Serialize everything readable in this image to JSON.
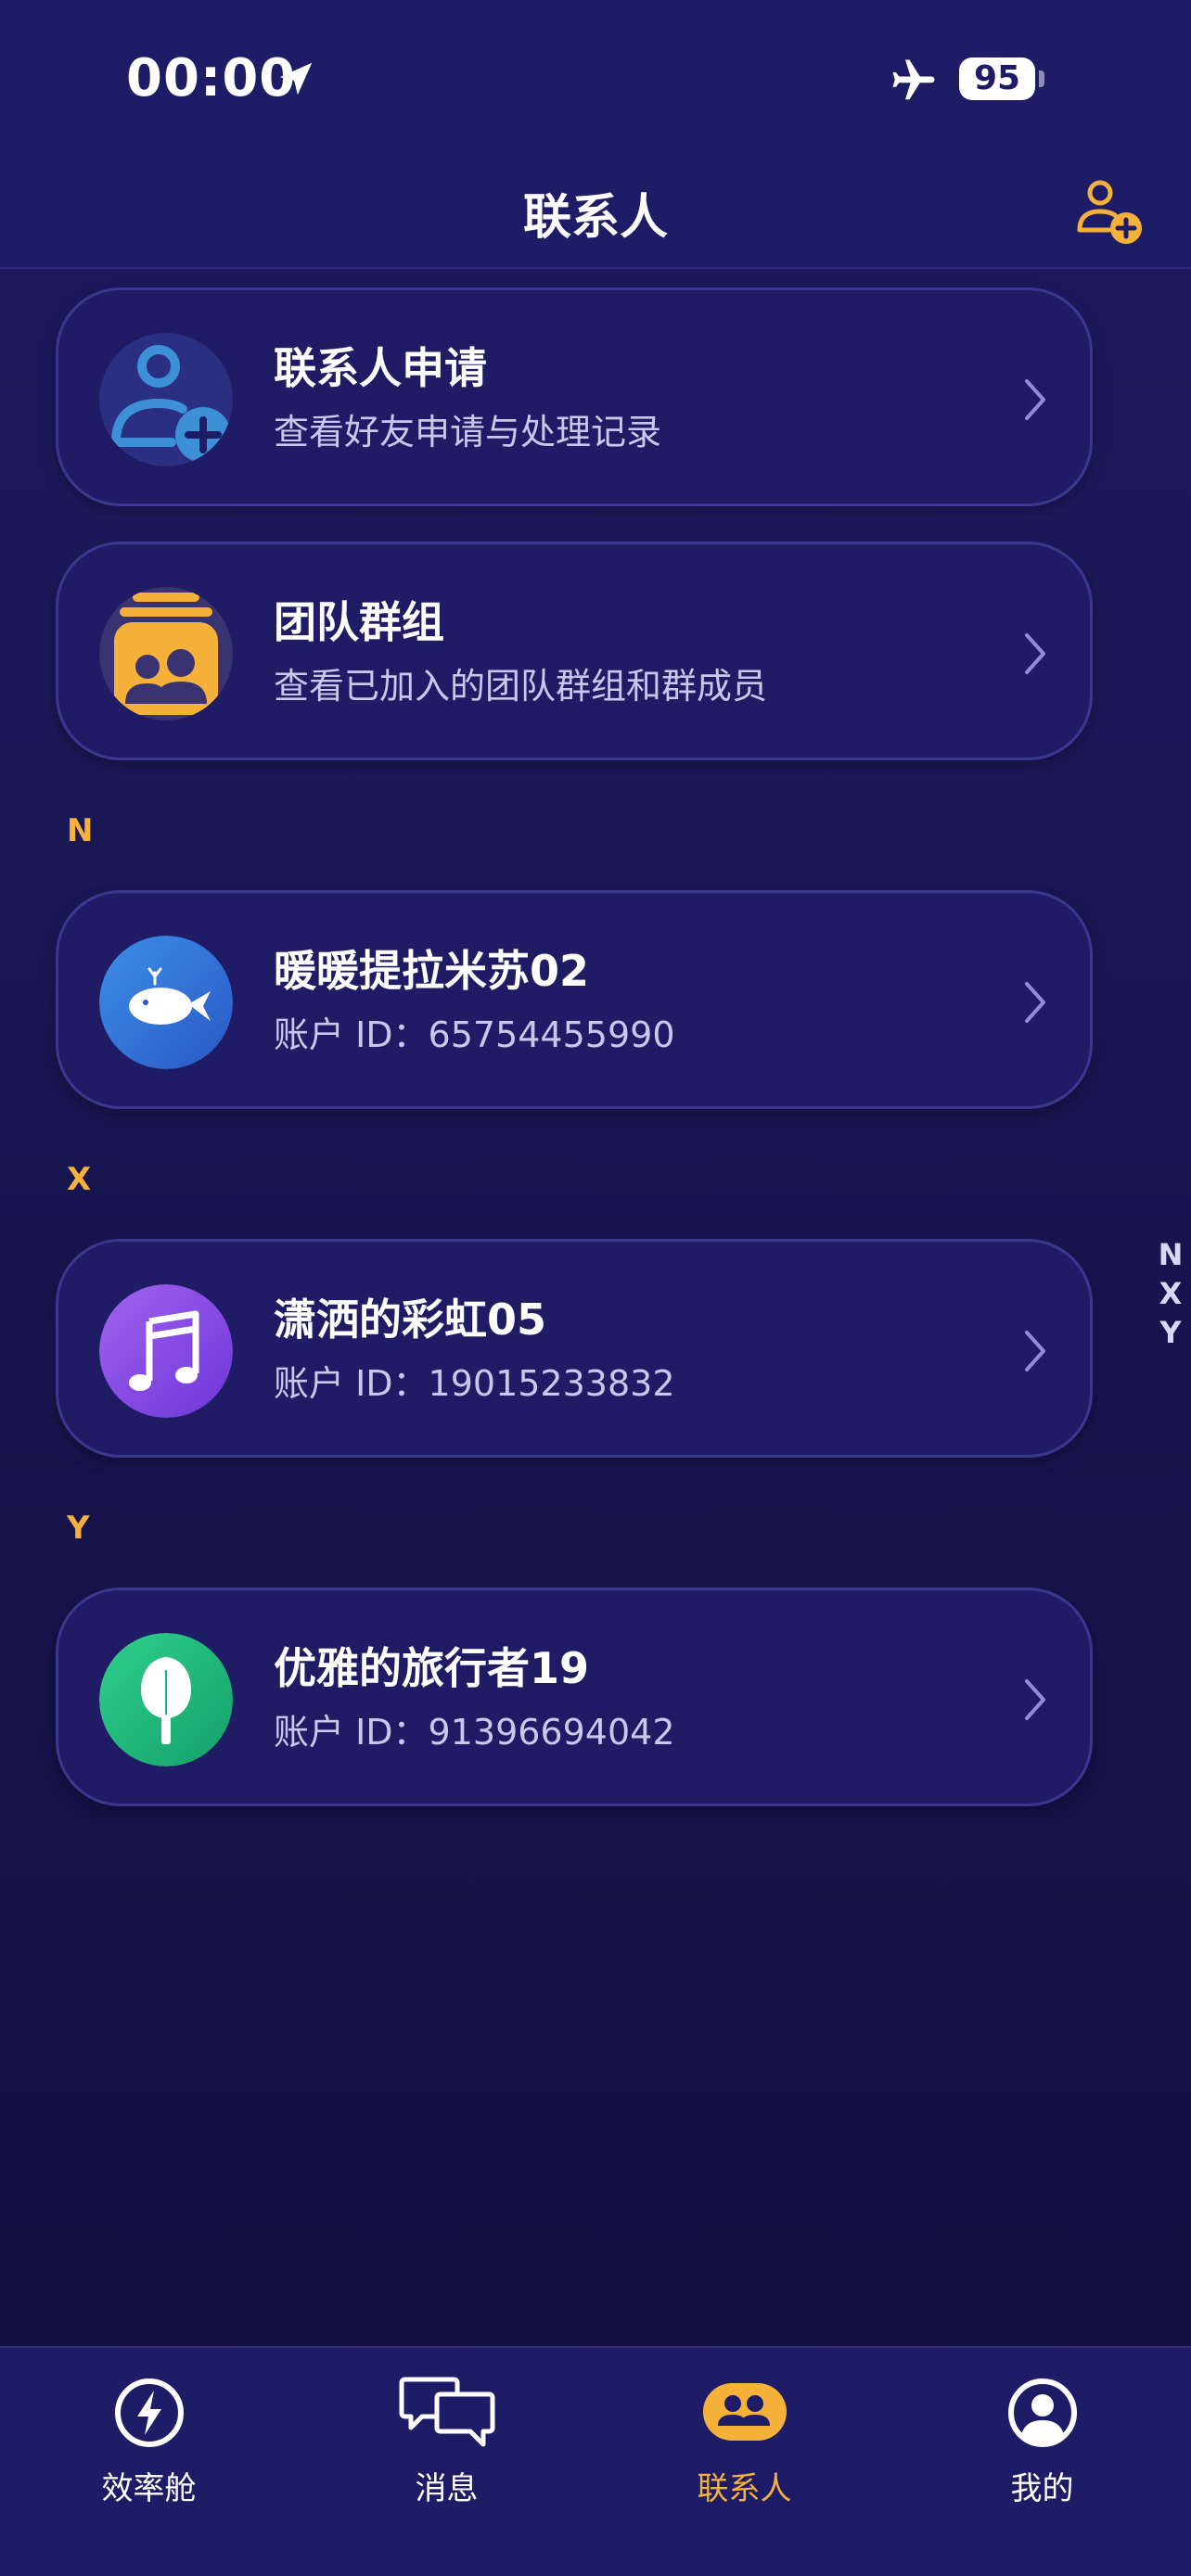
{
  "status_bar": {
    "time": "00:00",
    "battery": "95"
  },
  "nav": {
    "title": "联系人"
  },
  "special_entries": [
    {
      "title": "联系人申请",
      "subtitle": "查看好友申请与处理记录"
    },
    {
      "title": "团队群组",
      "subtitle": "查看已加入的团队群组和群成员"
    }
  ],
  "sections": [
    {
      "letter": "N",
      "contact": {
        "name": "暖暖提拉米苏02",
        "account": "账户 ID：65754455990"
      }
    },
    {
      "letter": "X",
      "contact": {
        "name": "潇洒的彩虹05",
        "account": "账户 ID：19015233832"
      }
    },
    {
      "letter": "Y",
      "contact": {
        "name": "优雅的旅行者19",
        "account": "账户 ID：91396694042"
      }
    }
  ],
  "index_letters": [
    "N",
    "X",
    "Y"
  ],
  "tabs": [
    {
      "label": "效率舱",
      "icon": "bolt-icon"
    },
    {
      "label": "消息",
      "icon": "chat-icon"
    },
    {
      "label": "联系人",
      "icon": "contacts-icon",
      "active": true
    },
    {
      "label": "我的",
      "icon": "profile-icon"
    }
  ],
  "colors": {
    "accent": "#f5b13a",
    "background": "#1a1855",
    "card": "#1f1c65"
  }
}
